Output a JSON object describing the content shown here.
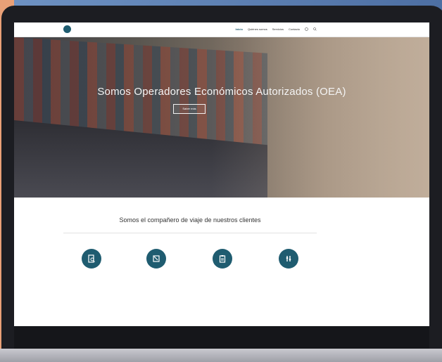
{
  "nav": {
    "logo_text": "",
    "items": [
      "Inicio",
      "Quiénes somos",
      "Servicios",
      "Contacto"
    ]
  },
  "hero": {
    "title": "Somos Operadores Económicos Autorizados (OEA)",
    "button": "Saber más"
  },
  "section": {
    "title": "Somos el compañero de viaje de nuestros clientes"
  },
  "features": [
    {
      "icon": "document-search-icon",
      "title": "",
      "desc": ""
    },
    {
      "icon": "box-arrow-icon",
      "title": "",
      "desc": ""
    },
    {
      "icon": "clipboard-icon",
      "title": "",
      "desc": ""
    },
    {
      "icon": "tools-icon",
      "title": "",
      "desc": ""
    }
  ],
  "colors": {
    "accent": "#1f5c70",
    "background": "#5679ad",
    "strip": "#e9a077"
  }
}
